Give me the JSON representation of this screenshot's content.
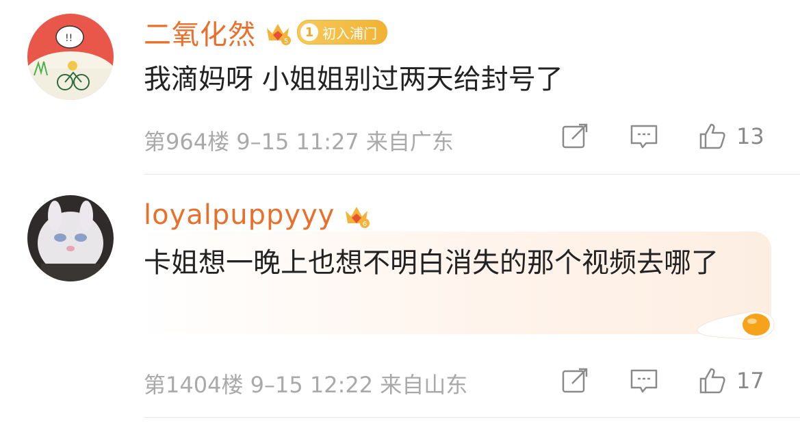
{
  "comments": [
    {
      "username": "二氧化然",
      "crown_level": "5",
      "badge_num": "1",
      "badge_text": "初入浦门",
      "text": "我滴妈呀 小姐姐别过两天给封号了",
      "meta": "第964楼 9–15 11:27 来自广东",
      "likes": "13"
    },
    {
      "username": "loyalpuppyyy",
      "crown_level": "6",
      "text": "卡姐想一晚上也想不明白消失的那个视频去哪了",
      "meta": "第1404楼 9–15 12:22 来自山东",
      "likes": "17"
    }
  ],
  "icons": {
    "share": "share-icon",
    "reply": "comment-icon",
    "like": "thumbs-up-icon",
    "crown": "crown-icon"
  },
  "colors": {
    "username": "#e8702a",
    "badge": "#f1b233",
    "meta": "#a9a9a9"
  }
}
